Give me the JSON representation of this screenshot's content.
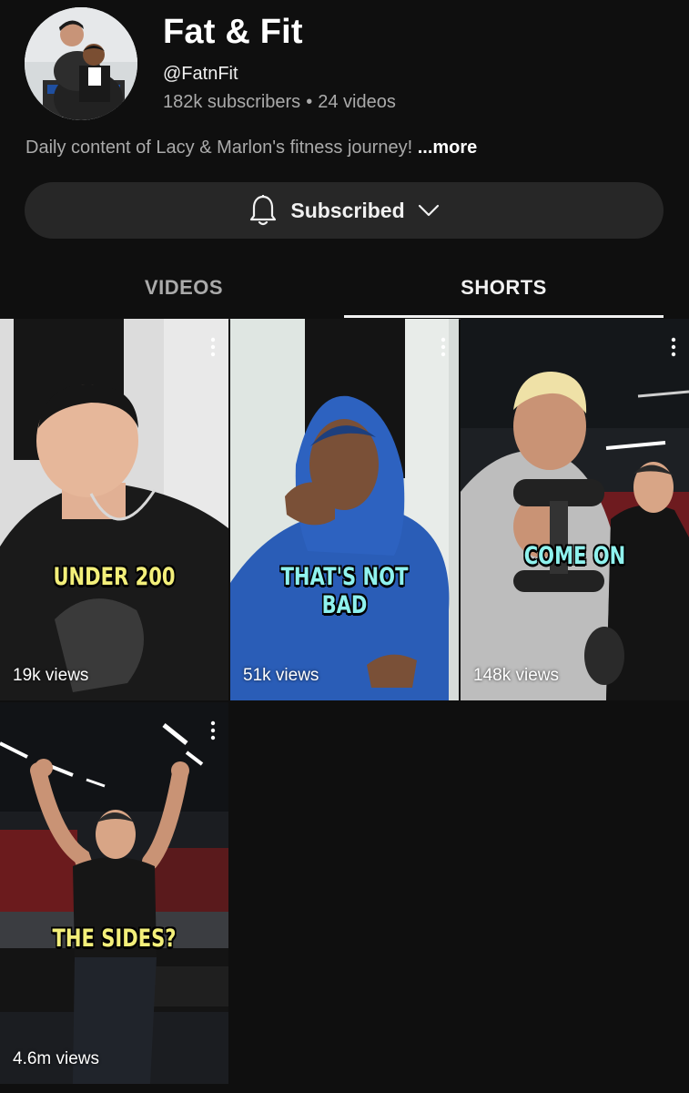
{
  "channel": {
    "name": "Fat & Fit",
    "handle": "@FatnFit",
    "subscribers": "182k subscribers",
    "separator": "•",
    "videos": "24 videos",
    "description": "Daily content of Lacy & Marlon's fitness journey!",
    "more_label": "...more",
    "avatar_icon": "channel-avatar-photo"
  },
  "subscribe_button": {
    "label": "Subscribed",
    "bell_icon": "bell-icon",
    "chevron_icon": "chevron-down-icon"
  },
  "tabs": [
    {
      "label": "VIDEOS",
      "selected": false
    },
    {
      "label": "SHORTS",
      "selected": true
    }
  ],
  "shorts": [
    {
      "caption": "UNDER 200",
      "views": "19k views",
      "caption_color": "#f3ef7a"
    },
    {
      "caption": "THAT'S NOT BAD",
      "views": "51k views",
      "caption_color": "#8ff2ee"
    },
    {
      "caption": "COME ON",
      "views": "148k views",
      "caption_color": "#8ff2ee"
    },
    {
      "caption": "THE SIDES?",
      "views": "4.6m views",
      "caption_color": "#f3ef7a"
    }
  ],
  "colors": {
    "background": "#0f0f0f",
    "button_bg": "#272727",
    "secondary_text": "#aaaaaa"
  }
}
